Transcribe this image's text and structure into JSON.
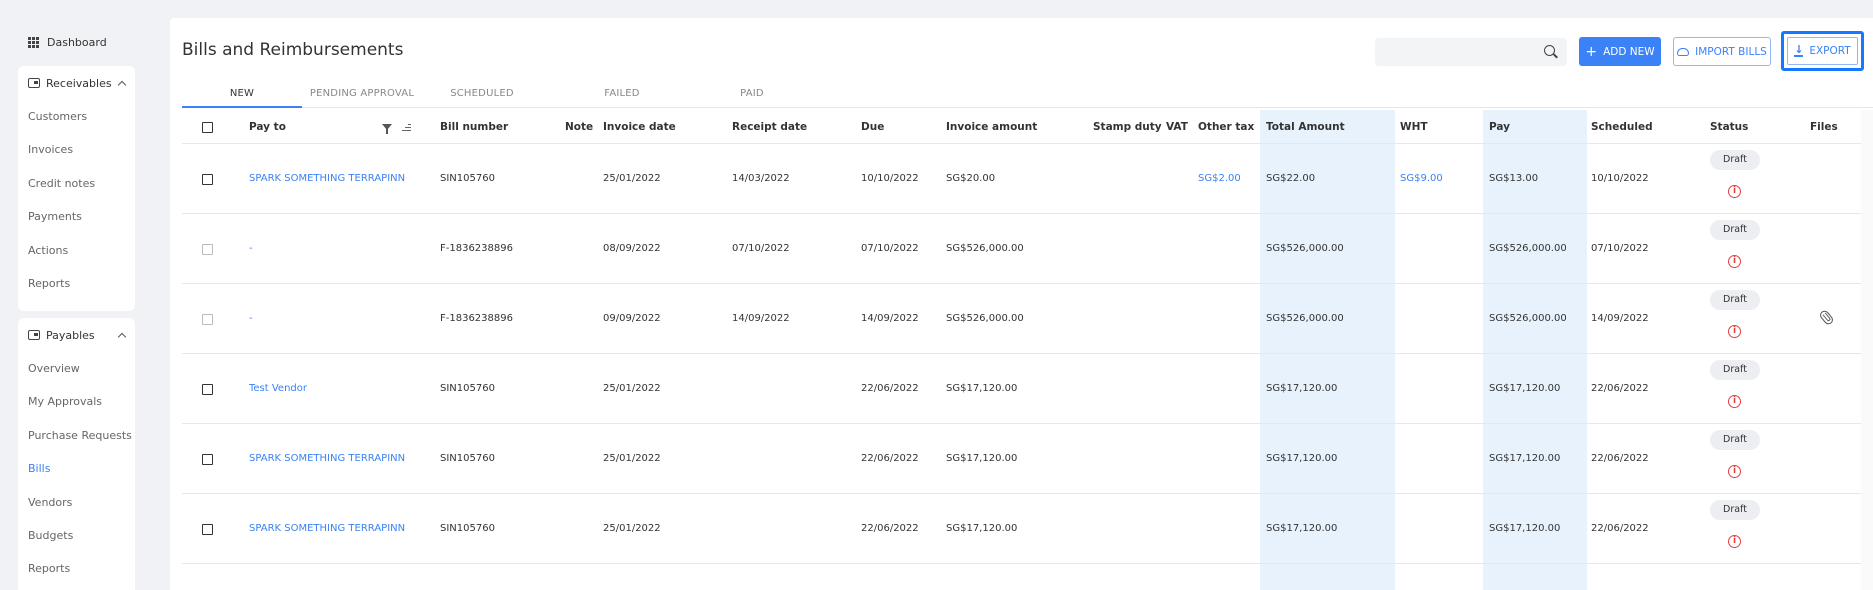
{
  "sidebar": {
    "dashboard": "Dashboard",
    "receivables": {
      "title": "Receivables",
      "items": [
        "Customers",
        "Invoices",
        "Credit notes",
        "Payments",
        "Actions",
        "Reports"
      ]
    },
    "payables": {
      "title": "Payables",
      "items": [
        "Overview",
        "My Approvals",
        "Purchase Requests",
        "Bills",
        "Vendors",
        "Budgets",
        "Reports"
      ],
      "active": "Bills"
    }
  },
  "header": {
    "title": "Bills and Reimbursements",
    "search_placeholder": "",
    "add_new": "ADD NEW",
    "import_bills": "IMPORT BILLS",
    "export": "EXPORT"
  },
  "tabs": [
    "NEW",
    "PENDING APPROVAL",
    "SCHEDULED",
    "FAILED",
    "PAID"
  ],
  "active_tab": "NEW",
  "table": {
    "columns": [
      "Pay to",
      "Bill number",
      "Note",
      "Invoice date",
      "Receipt date",
      "Due",
      "Invoice amount",
      "Stamp duty",
      "VAT",
      "Other tax",
      "Total Amount",
      "WHT",
      "Pay",
      "Scheduled",
      "Status",
      "Files"
    ],
    "rows": [
      {
        "pay_to": "SPARK SOMETHING TERRAPINN",
        "bill_number": "SIN105760",
        "note": "",
        "invoice_date": "25/01/2022",
        "receipt_date": "14/03/2022",
        "due": "10/10/2022",
        "invoice_amount": "SG$20.00",
        "stamp_duty": "",
        "vat": "",
        "other_tax": "SG$2.00",
        "total_amount": "SG$22.00",
        "wht": "SG$9.00",
        "pay": "SG$13.00",
        "scheduled": "10/10/2022",
        "status": "Draft",
        "has_file": false,
        "pay_to_link": true
      },
      {
        "pay_to": "-",
        "bill_number": "F-1836238896",
        "note": "",
        "invoice_date": "08/09/2022",
        "receipt_date": "07/10/2022",
        "due": "07/10/2022",
        "invoice_amount": "SG$526,000.00",
        "stamp_duty": "",
        "vat": "",
        "other_tax": "",
        "total_amount": "SG$526,000.00",
        "wht": "",
        "pay": "SG$526,000.00",
        "scheduled": "07/10/2022",
        "status": "Draft",
        "has_file": false,
        "pay_to_link": true
      },
      {
        "pay_to": "-",
        "bill_number": "F-1836238896",
        "note": "",
        "invoice_date": "09/09/2022",
        "receipt_date": "14/09/2022",
        "due": "14/09/2022",
        "invoice_amount": "SG$526,000.00",
        "stamp_duty": "",
        "vat": "",
        "other_tax": "",
        "total_amount": "SG$526,000.00",
        "wht": "",
        "pay": "SG$526,000.00",
        "scheduled": "14/09/2022",
        "status": "Draft",
        "has_file": true,
        "pay_to_link": true
      },
      {
        "pay_to": "Test Vendor",
        "bill_number": "SIN105760",
        "note": "",
        "invoice_date": "25/01/2022",
        "receipt_date": "",
        "due": "22/06/2022",
        "invoice_amount": "SG$17,120.00",
        "stamp_duty": "",
        "vat": "",
        "other_tax": "",
        "total_amount": "SG$17,120.00",
        "wht": "",
        "pay": "SG$17,120.00",
        "scheduled": "22/06/2022",
        "status": "Draft",
        "has_file": false,
        "pay_to_link": true
      },
      {
        "pay_to": "SPARK SOMETHING TERRAPINN",
        "bill_number": "SIN105760",
        "note": "",
        "invoice_date": "25/01/2022",
        "receipt_date": "",
        "due": "22/06/2022",
        "invoice_amount": "SG$17,120.00",
        "stamp_duty": "",
        "vat": "",
        "other_tax": "",
        "total_amount": "SG$17,120.00",
        "wht": "",
        "pay": "SG$17,120.00",
        "scheduled": "22/06/2022",
        "status": "Draft",
        "has_file": false,
        "pay_to_link": true
      },
      {
        "pay_to": "SPARK SOMETHING TERRAPINN",
        "bill_number": "SIN105760",
        "note": "",
        "invoice_date": "25/01/2022",
        "receipt_date": "",
        "due": "22/06/2022",
        "invoice_amount": "SG$17,120.00",
        "stamp_duty": "",
        "vat": "",
        "other_tax": "",
        "total_amount": "SG$17,120.00",
        "wht": "",
        "pay": "SG$17,120.00",
        "scheduled": "22/06/2022",
        "status": "Draft",
        "has_file": false,
        "pay_to_link": true
      }
    ]
  },
  "colors": {
    "accent": "#3b82f6",
    "highlight_column": "#e8f2fd",
    "error": "#e53e3e"
  }
}
